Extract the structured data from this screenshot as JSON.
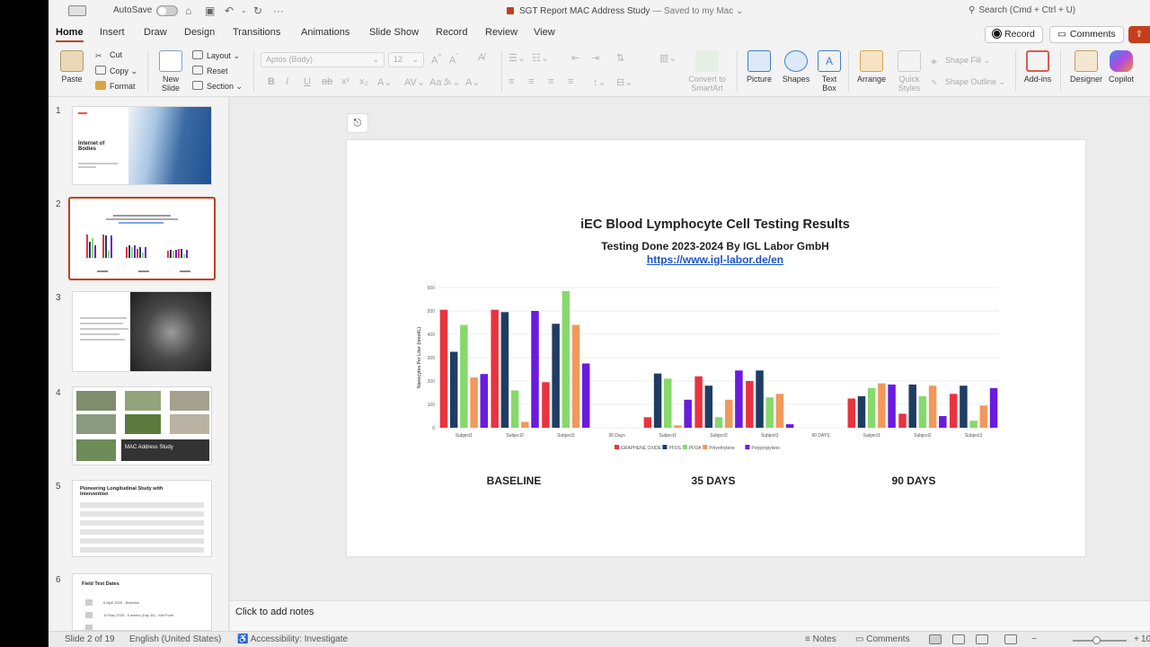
{
  "titlebar": {
    "autosave_label": "AutoSave",
    "document_title": "SGT Report MAC Address Study",
    "saved_status": "— Saved to my Mac ⌄",
    "search_placeholder": "Search (Cmd + Ctrl + U)"
  },
  "tabs": [
    "Home",
    "Insert",
    "Draw",
    "Design",
    "Transitions",
    "Animations",
    "Slide Show",
    "Record",
    "Review",
    "View"
  ],
  "active_tab": "Home",
  "header_buttons": {
    "record": "Record",
    "comments": "Comments"
  },
  "ribbon": {
    "paste": "Paste",
    "cut": "Cut",
    "copy": "Copy",
    "format": "Format",
    "new_slide_line1": "New",
    "new_slide_line2": "Slide",
    "layout": "Layout",
    "reset": "Reset",
    "section": "Section",
    "font_name": "Aptos (Body)",
    "font_size": "12",
    "convert_line1": "Convert to",
    "convert_line2": "SmartArt",
    "picture": "Picture",
    "shapes": "Shapes",
    "text_box_line1": "Text",
    "text_box_line2": "Box",
    "arrange": "Arrange",
    "quick_styles_line1": "Quick",
    "quick_styles_line2": "Styles",
    "shape_fill": "Shape Fill",
    "shape_outline": "Shape Outline",
    "add_ins": "Add-ins",
    "designer": "Designer",
    "copilot": "Copilot"
  },
  "thumbnails": [
    {
      "number": "1",
      "title": "Internet of Bodies"
    },
    {
      "number": "2",
      "title": ""
    },
    {
      "number": "3",
      "title": ""
    },
    {
      "number": "4",
      "caption": "MAC Address Study"
    },
    {
      "number": "5",
      "title": "Pioneering Longitudinal Study with Intervention"
    },
    {
      "number": "6",
      "title": "Field Test Dates",
      "lines": [
        "6 April 2025 - Baseline",
        "10 May 2025 - 5 weeks (Day 35) - Mid Point"
      ]
    }
  ],
  "slide": {
    "title": "iEC Blood Lymphocyte Cell Testing Results",
    "subtitle": "Testing Done 2023-2024 By IGL Labor GmbH",
    "link": "https://www.igl-labor.de/en",
    "group_labels": [
      "BASELINE",
      "35 DAYS",
      "90 DAYS"
    ]
  },
  "chart_data": {
    "type": "bar",
    "ylabel": "Nanocytes Per Liter (nmol/L)",
    "ylim": [
      0,
      600
    ],
    "yticks": [
      0,
      100,
      200,
      300,
      400,
      500,
      600
    ],
    "categories": [
      "Subject1",
      "Subject2",
      "Subject3",
      "35 Days",
      "Subject1",
      "Subject2",
      "Subject3",
      "90 DAYS",
      "Subject1",
      "Subject2",
      "Subject3"
    ],
    "series": [
      {
        "name": "GRAPHENE OXIDE",
        "color": "#e8343f",
        "values": [
          505,
          505,
          195,
          0,
          45,
          220,
          200,
          0,
          125,
          60,
          145
        ]
      },
      {
        "name": "PFOS",
        "color": "#1f3d63",
        "values": [
          325,
          495,
          445,
          0,
          232,
          180,
          245,
          0,
          135,
          185,
          180
        ]
      },
      {
        "name": "PFOA",
        "color": "#86d96b",
        "values": [
          440,
          160,
          585,
          0,
          210,
          45,
          130,
          0,
          170,
          135,
          30
        ]
      },
      {
        "name": "Polyethylene",
        "color": "#f0995a",
        "values": [
          215,
          25,
          440,
          0,
          10,
          120,
          145,
          0,
          190,
          180,
          95
        ]
      },
      {
        "name": "Polypropylene",
        "color": "#6a1be0",
        "values": [
          230,
          500,
          275,
          0,
          120,
          245,
          15,
          0,
          185,
          50,
          170
        ]
      }
    ]
  },
  "notes_placeholder": "Click to add notes",
  "statusbar": {
    "slide_counter": "Slide 2 of 19",
    "language": "English (United States)",
    "accessibility": "Accessibility: Investigate",
    "notes": "Notes",
    "comments": "Comments",
    "zoom": "107"
  }
}
